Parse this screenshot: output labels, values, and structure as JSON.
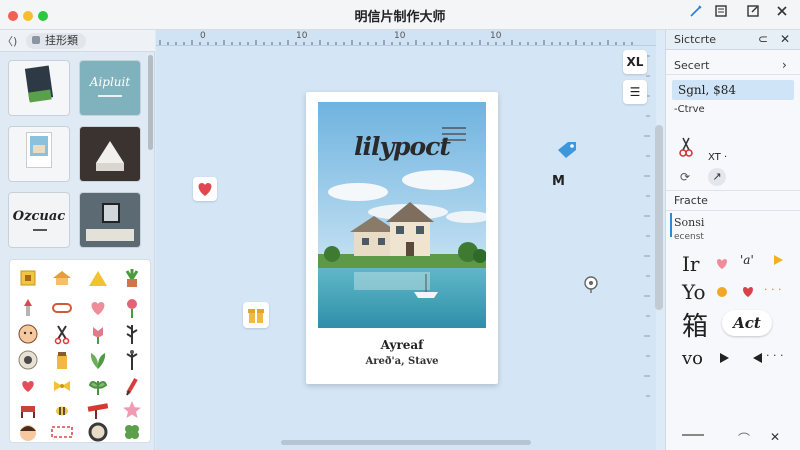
{
  "window": {
    "title": "明信片制作大师"
  },
  "titlebar_icons": [
    "pen-icon",
    "gallery-icon",
    "edit-icon",
    "close-icon"
  ],
  "left": {
    "back_label": "〈)",
    "tab_label": "挂形類",
    "templates": [
      {
        "name": "template-thumb-1"
      },
      {
        "name": "template-thumb-2",
        "label": "Aipluit"
      },
      {
        "name": "template-thumb-3"
      },
      {
        "name": "template-thumb-4"
      },
      {
        "name": "template-thumb-5",
        "label": "Ozcuac"
      },
      {
        "name": "template-thumb-6"
      }
    ]
  },
  "canvas": {
    "ruler_marks": [
      "0",
      "10",
      "10",
      "10"
    ],
    "card": {
      "photo_script": "lilypoct",
      "title": "Ayreaf",
      "subtitle": "Areð'a, Stave"
    },
    "buttons": {
      "text_tool": "XL",
      "align_tool": "☰"
    },
    "floating_label": "M"
  },
  "right": {
    "header_title": "Sictcrte",
    "section_select": "Secert",
    "selected_font": "Sgnl, $84",
    "option": "-Ctrve",
    "tool_label": "XT ·",
    "section_font": "Fracte",
    "font_size_label": "Sonsi",
    "font_size_sub": "ecenst",
    "font_samples": [
      "Ir",
      "Yo",
      "箱",
      "vo"
    ],
    "font_extra": "Act",
    "accent": "#2a8ad8"
  }
}
